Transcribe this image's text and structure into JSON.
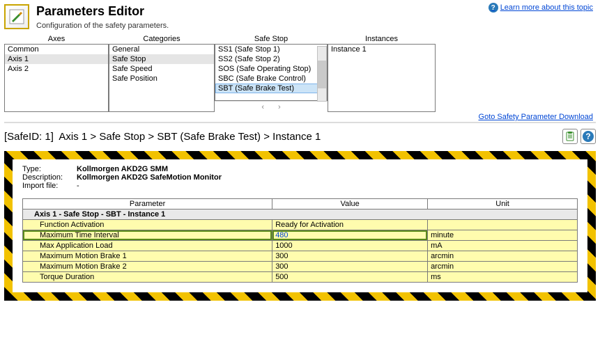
{
  "header": {
    "title": "Parameters Editor",
    "subtitle": "Configuration of the safety parameters.",
    "learn_label": "Learn more about this topic",
    "goto_label": "Goto Safety Parameter Download"
  },
  "lists": {
    "axes": {
      "header": "Axes",
      "items": [
        "Common",
        "Axis 1",
        "Axis 2"
      ],
      "selected": "Axis 1"
    },
    "categories": {
      "header": "Categories",
      "items": [
        "General",
        "Safe Stop",
        "Safe Speed",
        "Safe Position"
      ],
      "selected": "Safe Stop"
    },
    "safestop": {
      "header": "Safe Stop",
      "items": [
        "SS1 (Safe Stop 1)",
        "SS2 (Safe Stop 2)",
        "SOS (Safe Operating Stop)",
        "SBC (Safe Brake Control)",
        "SBT (Safe Brake Test)"
      ],
      "selected": "SBT (Safe Brake Test)"
    },
    "instances": {
      "header": "Instances",
      "items": [
        "Instance 1"
      ]
    }
  },
  "breadcrumb": {
    "safeid_label": "[SafeID: 1]",
    "parts": [
      "Axis 1",
      "Safe Stop",
      "SBT (Safe Brake Test)",
      "Instance 1"
    ]
  },
  "info": {
    "type_label": "Type:",
    "type_value": "Kollmorgen AKD2G SMM",
    "desc_label": "Description:",
    "desc_value": "Kollmorgen AKD2G SafeMotion Monitor",
    "import_label": "Import file:",
    "import_value": "-"
  },
  "table": {
    "cols": [
      "Parameter",
      "Value",
      "Unit"
    ],
    "group": "Axis 1 - Safe Stop - SBT - Instance 1",
    "rows": [
      {
        "param": "Function Activation",
        "value": "Ready for Activation",
        "unit": ""
      },
      {
        "param": "Maximum Time Interval",
        "value": "480",
        "unit": "minute",
        "edit": true,
        "marked": true
      },
      {
        "param": "Max Application Load",
        "value": "1000",
        "unit": "mA"
      },
      {
        "param": "Maximum Motion Brake 1",
        "value": "300",
        "unit": "arcmin"
      },
      {
        "param": "Maximum Motion Brake 2",
        "value": "300",
        "unit": "arcmin"
      },
      {
        "param": "Torque Duration",
        "value": "500",
        "unit": "ms"
      }
    ]
  }
}
